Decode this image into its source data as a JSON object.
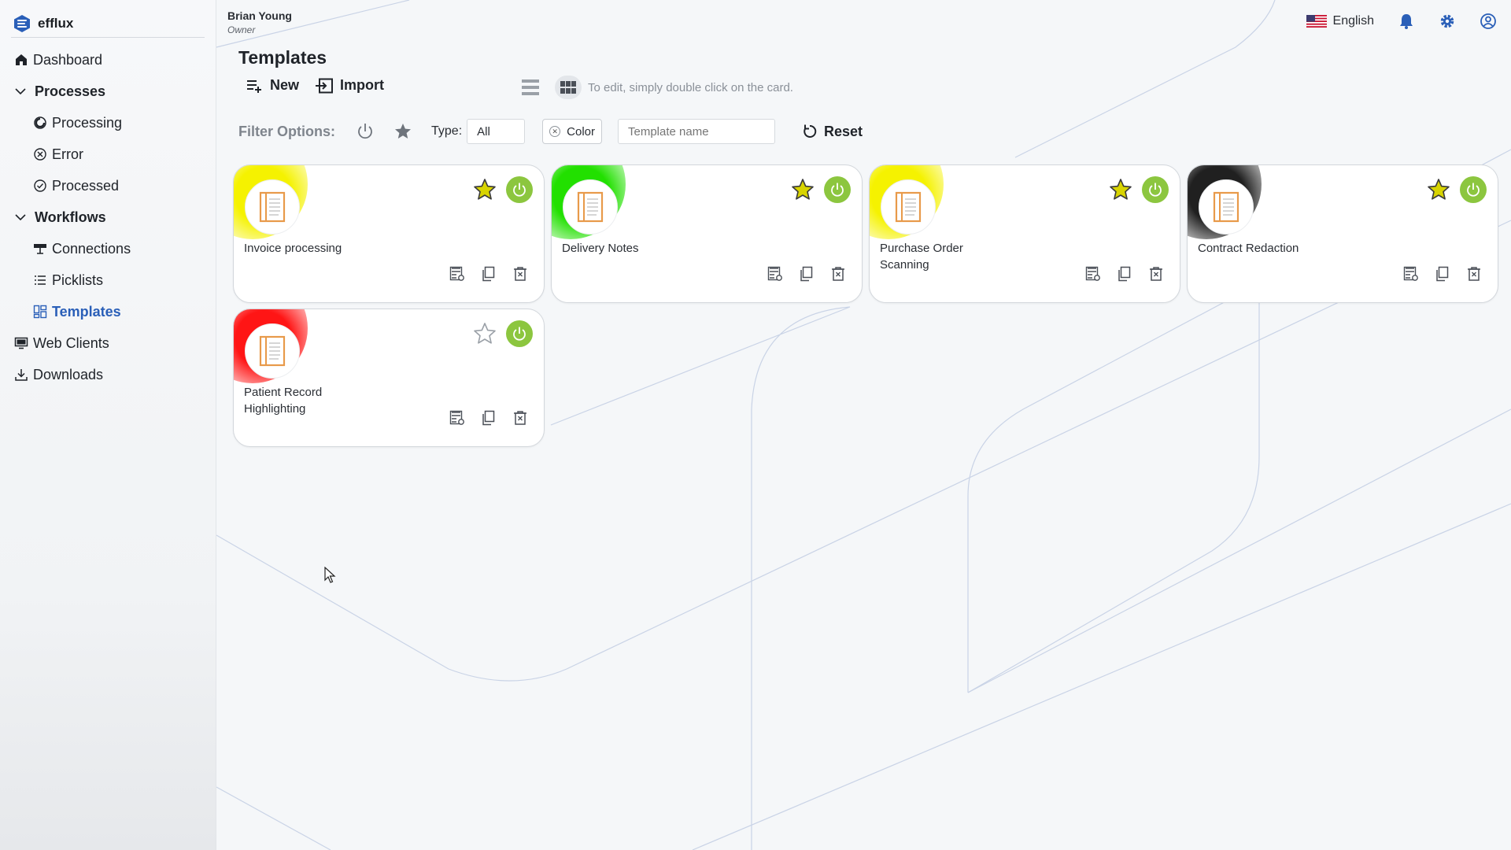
{
  "app": {
    "brand": "efflux",
    "accent": "#2a5fb8"
  },
  "user": {
    "name": "Brian Young",
    "role": "Owner"
  },
  "header": {
    "language": "English",
    "icons": [
      "flag-us-icon",
      "bell-icon",
      "gear-icon",
      "user-circle-icon"
    ]
  },
  "sidebar": {
    "items": [
      {
        "label": "Dashboard",
        "icon": "home-icon",
        "kind": "top"
      },
      {
        "label": "Processes",
        "icon": "chevron-down-icon",
        "kind": "group"
      },
      {
        "label": "Processing",
        "icon": "processing-icon",
        "kind": "sub"
      },
      {
        "label": "Error",
        "icon": "error-circle-icon",
        "kind": "sub"
      },
      {
        "label": "Processed",
        "icon": "check-circle-icon",
        "kind": "sub"
      },
      {
        "label": "Workflows",
        "icon": "chevron-down-icon",
        "kind": "group"
      },
      {
        "label": "Connections",
        "icon": "connections-icon",
        "kind": "sub"
      },
      {
        "label": "Picklists",
        "icon": "list-icon",
        "kind": "sub"
      },
      {
        "label": "Templates",
        "icon": "templates-icon",
        "kind": "sub",
        "active": true
      },
      {
        "label": "Web Clients",
        "icon": "monitor-icon",
        "kind": "top"
      },
      {
        "label": "Downloads",
        "icon": "download-icon",
        "kind": "top"
      }
    ]
  },
  "page": {
    "title": "Templates",
    "new_label": "New",
    "import_label": "Import",
    "hint": "To edit, simply double click on the card."
  },
  "filters": {
    "label": "Filter Options:",
    "type_label": "Type:",
    "type_value": "All",
    "color_chip": "Color",
    "name_placeholder": "Template name",
    "reset_label": "Reset"
  },
  "cards": [
    {
      "title": "Invoice processing",
      "color": "#f5f200",
      "favorite": true,
      "active": true
    },
    {
      "title": "Delivery Notes",
      "color": "#22e000",
      "favorite": true,
      "active": true
    },
    {
      "title": "Purchase Order Scanning",
      "color": "#f5f200",
      "favorite": true,
      "active": true
    },
    {
      "title": "Contract Redaction",
      "color": "#202020",
      "favorite": true,
      "active": true
    },
    {
      "title": "Patient Record Highlighting",
      "color": "#ff1515",
      "favorite": false,
      "active": true
    }
  ]
}
